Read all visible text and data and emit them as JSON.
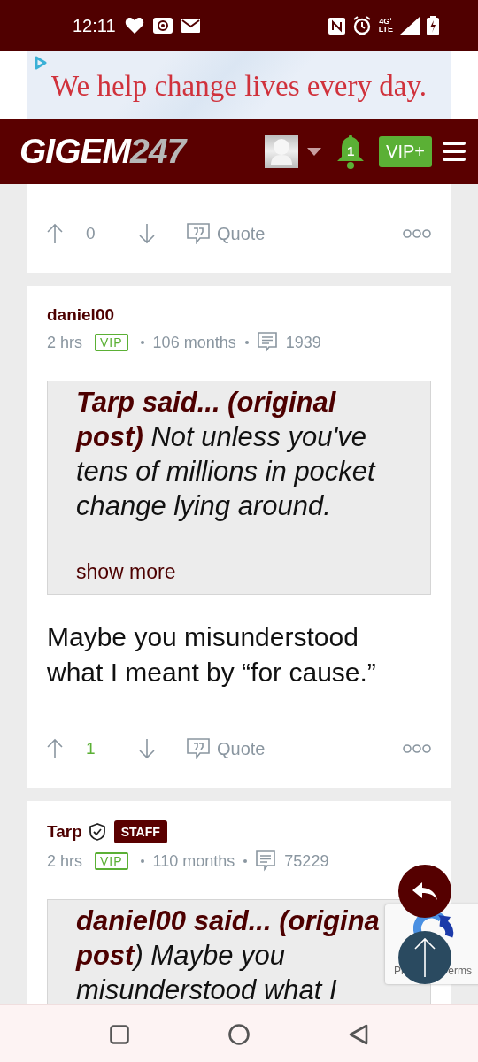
{
  "status_bar": {
    "time": "12:11",
    "network": "4G⁺\nLTE"
  },
  "ad": {
    "text": "We help change lives every day."
  },
  "header": {
    "logo_main": "GIGEM",
    "logo_accent": "247",
    "notifications": "1",
    "vip_button": "VIP+"
  },
  "posts": [
    {
      "score": "0",
      "upvoted": false,
      "quote_label": "Quote"
    },
    {
      "author": "daniel00",
      "time": "2 hrs",
      "badge": "VIP",
      "tenure": "106 months",
      "post_count": "1939",
      "quote": "**Tarp said... (original post)** Not unless you've tens of millions in pocket change lying around.",
      "show_more": "show more",
      "body": "Maybe you misunderstood what I meant by “for cause.”",
      "score": "1",
      "upvoted": true,
      "quote_label": "Quote"
    },
    {
      "author": "Tarp",
      "staff": "STAFF",
      "time": "2 hrs",
      "badge": "VIP",
      "tenure": "110 months",
      "post_count": "75229",
      "quote": "**daniel00 said... (origina**\n**post**) Maybe you misunderstood what I"
    }
  ],
  "recaptcha": {
    "left_text": "Pr",
    "right_text": "erms"
  }
}
